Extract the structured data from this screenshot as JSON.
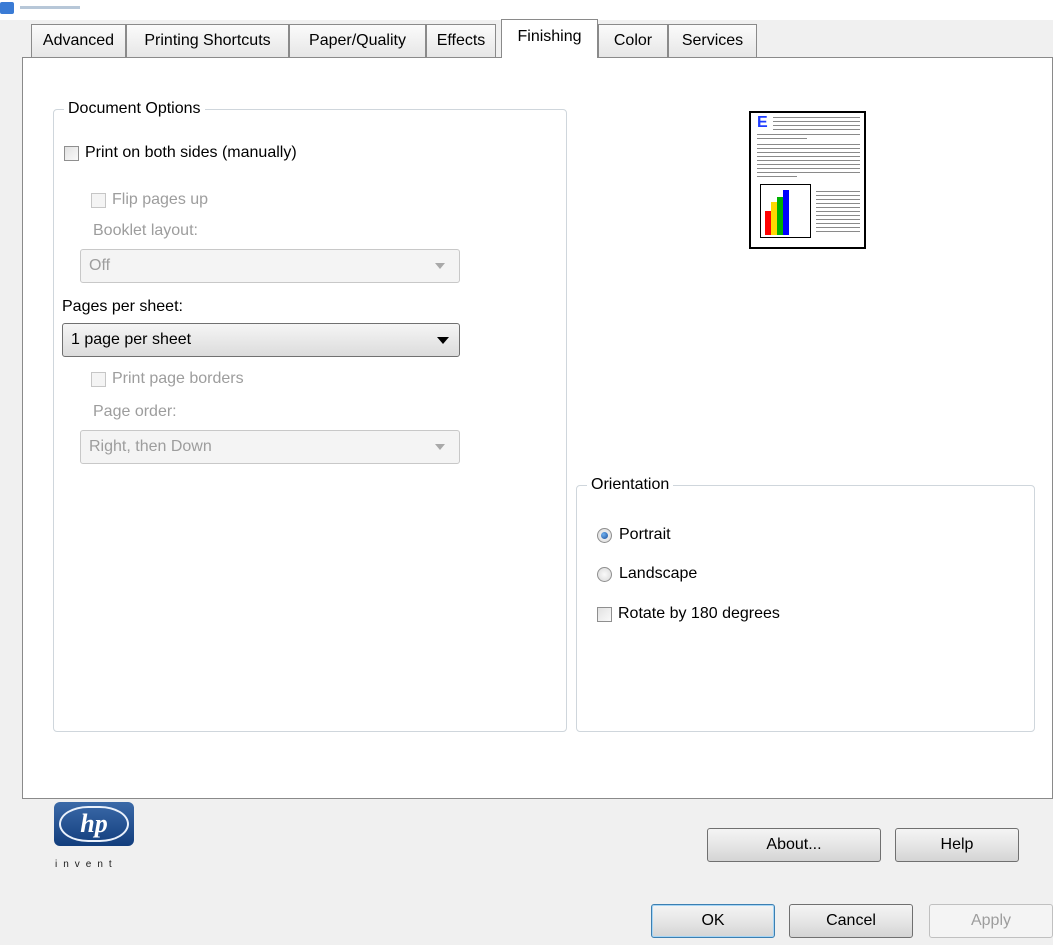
{
  "tabs": [
    "Advanced",
    "Printing Shortcuts",
    "Paper/Quality",
    "Effects",
    "Finishing",
    "Color",
    "Services"
  ],
  "active_tab": "Finishing",
  "document_options": {
    "title": "Document Options",
    "print_both_sides": {
      "label": "Print on both sides (manually)",
      "checked": false
    },
    "flip_pages_up": {
      "label": "Flip pages up",
      "checked": false,
      "enabled": false
    },
    "booklet_layout": {
      "label": "Booklet layout:",
      "value": "Off",
      "enabled": false
    },
    "pages_per_sheet": {
      "label": "Pages per sheet:",
      "value": "1 page per sheet"
    },
    "print_page_borders": {
      "label": "Print page borders",
      "checked": false,
      "enabled": false
    },
    "page_order": {
      "label": "Page order:",
      "value": "Right, then Down",
      "enabled": false
    }
  },
  "preview": {
    "letter": "E",
    "bar_colors": [
      "#ff0000",
      "#ffd800",
      "#00b000",
      "#0000ff"
    ]
  },
  "orientation": {
    "title": "Orientation",
    "portrait": {
      "label": "Portrait",
      "selected": true
    },
    "landscape": {
      "label": "Landscape",
      "selected": false
    },
    "rotate_180": {
      "label": "Rotate by 180 degrees",
      "checked": false
    }
  },
  "logo": {
    "brand": "hp",
    "tagline": "invent"
  },
  "buttons": {
    "about": "About...",
    "help": "Help",
    "ok": "OK",
    "cancel": "Cancel",
    "apply": "Apply"
  }
}
